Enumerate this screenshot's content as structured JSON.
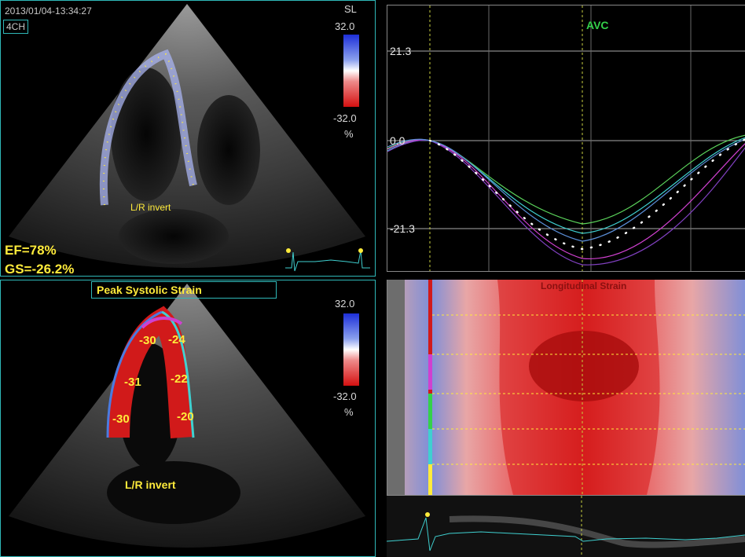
{
  "top_left": {
    "timestamp": "2013/01/04-13:34:27",
    "view_label": "4CH",
    "mode_label": "SL",
    "scale_max": "32.0",
    "scale_min": "-32.0",
    "scale_unit": "%",
    "orientation_label": "L/R invert",
    "ef_label": "EF=78%",
    "gs_label": "GS=-26.2%"
  },
  "bottom_left": {
    "title": "Peak Systolic Strain",
    "scale_max": "32.0",
    "scale_min": "-32.0",
    "scale_unit": "%",
    "orientation_label": "L/R invert",
    "segment_values": [
      "-30",
      "-24",
      "-31",
      "-22",
      "-30",
      "-20"
    ]
  },
  "top_right": {
    "event_label": "AVC",
    "y_top": "21.3",
    "y_zero": "0.0",
    "y_bottom": "-21.3"
  },
  "middle_right": {
    "title": "Longitudinal Strain"
  },
  "colors": {
    "frame": "#2fb8b8",
    "label_yellow": "#ffeb3b",
    "avc_green": "#34d14a",
    "strain_red": "#d11a1a",
    "strain_blue": "#6f7fd6"
  }
}
